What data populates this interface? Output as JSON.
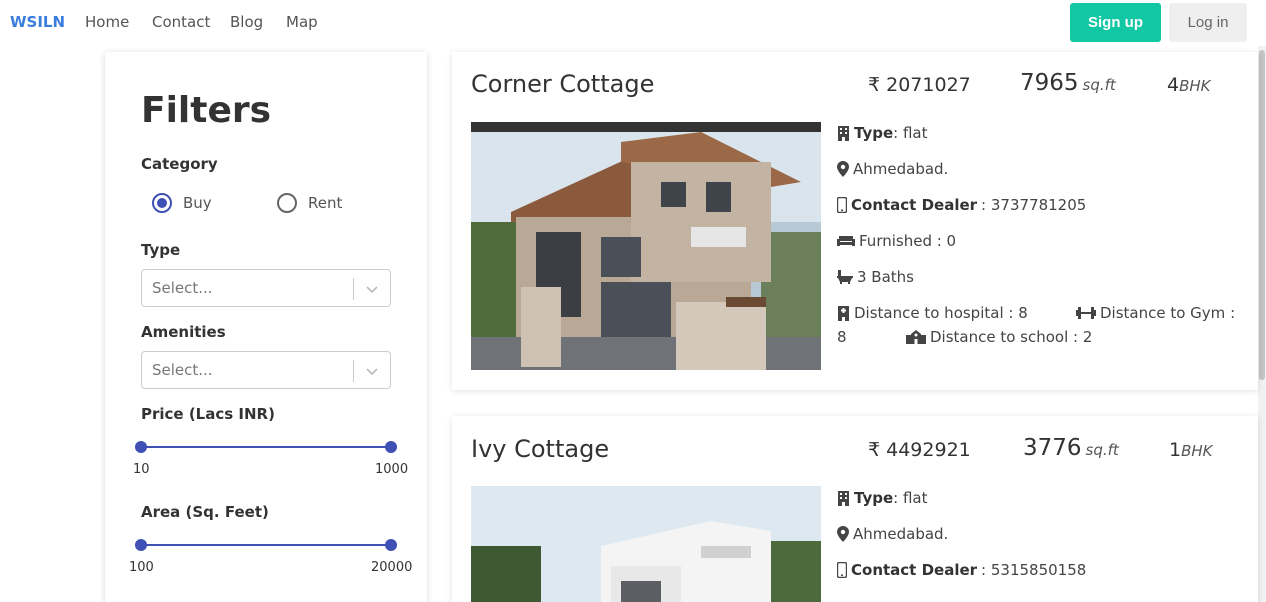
{
  "nav": {
    "brand": "WSILN",
    "links": [
      "Home",
      "Contact",
      "Blog",
      "Map"
    ],
    "signup": "Sign up",
    "login": "Log in"
  },
  "filters": {
    "title": "Filters",
    "category_label": "Category",
    "category_options": [
      "Buy",
      "Rent"
    ],
    "category_selected": "Buy",
    "type_label": "Type",
    "type_placeholder": "Select...",
    "amenities_label": "Amenities",
    "amenities_placeholder": "Select...",
    "price_label": "Price (Lacs INR)",
    "price_min": "10",
    "price_max": "1000",
    "area_label": "Area (Sq. Feet)",
    "area_min": "100",
    "area_max": "20000"
  },
  "listings": [
    {
      "title": "Corner Cottage",
      "price": "₹ 2071027",
      "area": "7965",
      "area_unit": "sq.ft",
      "bhk": "4",
      "bhk_unit": "BHK",
      "type_label": "Type",
      "type_value": ": flat",
      "location": "Ahmedabad.",
      "contact_label": "Contact Dealer",
      "contact_value": ": 3737781205",
      "furnished": "Furnished : 0",
      "baths": "3 Baths",
      "hospital": "Distance to hospital : 8",
      "gym": "Distance to Gym :",
      "gym_value": "8",
      "school": "Distance to school : 2"
    },
    {
      "title": "Ivy Cottage",
      "price": "₹ 4492921",
      "area": "3776",
      "area_unit": "sq.ft",
      "bhk": "1",
      "bhk_unit": "BHK",
      "type_label": "Type",
      "type_value": ": flat",
      "location": "Ahmedabad.",
      "contact_label": "Contact Dealer",
      "contact_value": ": 5315850158"
    }
  ],
  "icons": {
    "building": "building-icon",
    "location": "map-marker-icon",
    "phone": "mobile-phone-icon",
    "couch": "couch-icon",
    "bath": "bath-icon",
    "hospital": "hospital-icon",
    "gym": "dumbbell-icon",
    "school": "school-icon",
    "chevron": "chevron-down-icon"
  },
  "colors": {
    "brand": "#3b7ddd",
    "signup": "#11c7a4",
    "accent": "#3f51b5"
  }
}
